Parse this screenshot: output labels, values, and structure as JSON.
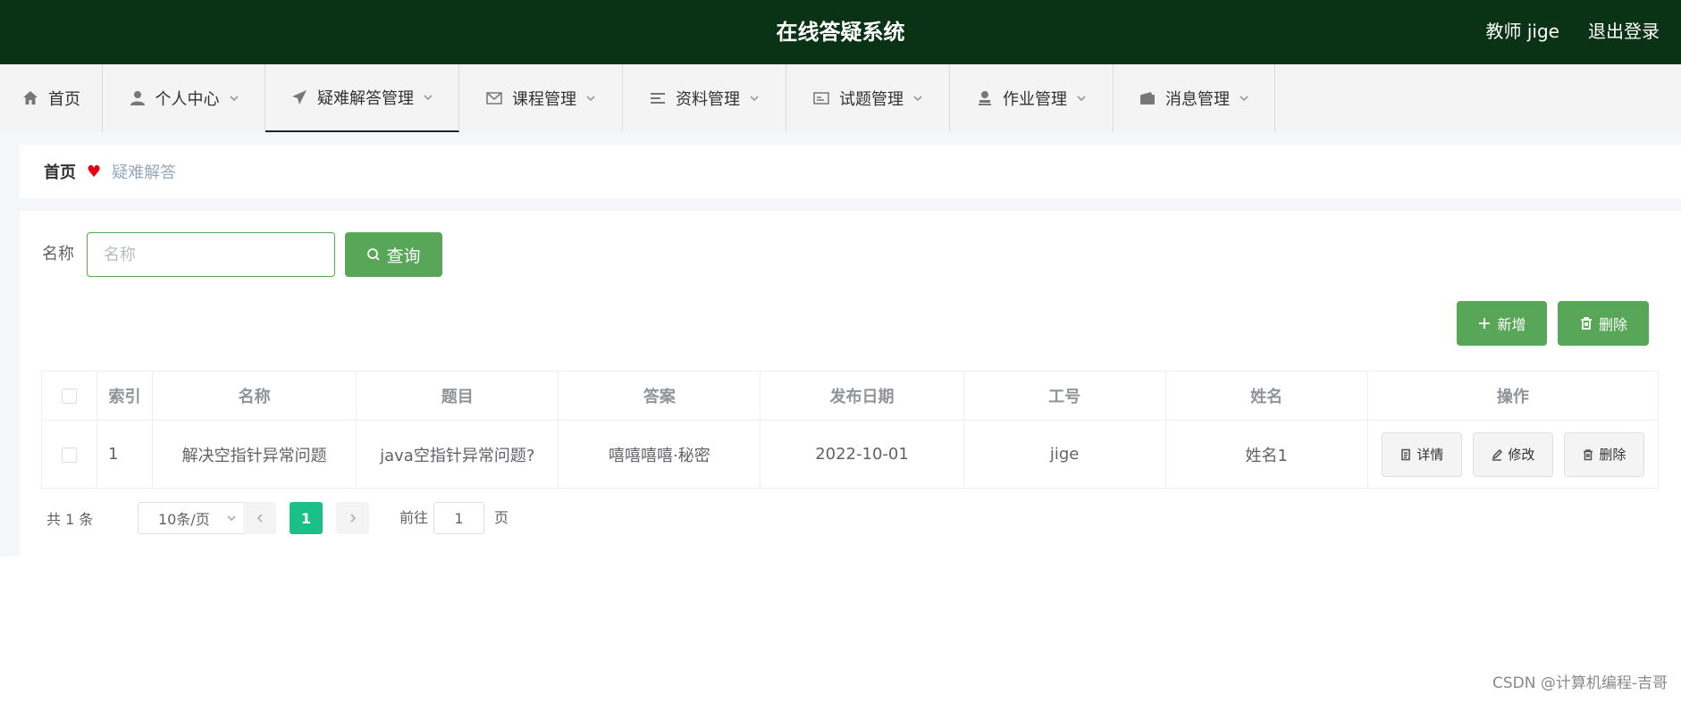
{
  "header": {
    "title": "在线答疑系统",
    "user": "教师 jige",
    "logout": "退出登录"
  },
  "nav": {
    "items": [
      {
        "label": "首页",
        "icon": "home-icon"
      },
      {
        "label": "个人中心",
        "icon": "user-icon"
      },
      {
        "label": "疑难解答管理",
        "icon": "paper-plane-icon"
      },
      {
        "label": "课程管理",
        "icon": "mail-icon"
      },
      {
        "label": "资料管理",
        "icon": "list-icon"
      },
      {
        "label": "试题管理",
        "icon": "card-icon"
      },
      {
        "label": "作业管理",
        "icon": "stamp-icon"
      },
      {
        "label": "消息管理",
        "icon": "wallet-icon"
      }
    ],
    "active_index": 2
  },
  "breadcrumb": {
    "home": "首页",
    "current": "疑难解答"
  },
  "search": {
    "label": "名称",
    "placeholder": "名称",
    "query_button": "查询"
  },
  "actions": {
    "add": "新增",
    "delete": "删除"
  },
  "table": {
    "headers": [
      "索引",
      "名称",
      "题目",
      "答案",
      "发布日期",
      "工号",
      "姓名",
      "操作"
    ],
    "rows": [
      {
        "index": "1",
        "name": "解决空指针异常问题",
        "question": "java空指针异常问题?",
        "answer": "嘻嘻嘻嘻·秘密",
        "date": "2022-10-01",
        "job_no": "jige",
        "person": "姓名1"
      }
    ],
    "row_ops": {
      "detail": "详情",
      "edit": "修改",
      "delete": "删除"
    }
  },
  "pagination": {
    "total": "共 1 条",
    "page_size": "10条/页",
    "current_page": "1",
    "goto_label": "前往",
    "goto_value": "1",
    "goto_unit": "页"
  },
  "watermark": "CSDN @计算机编程-吉哥",
  "colors": {
    "header_bg": "#0a3316",
    "primary_green": "#58a658",
    "page_active": "#1bc088"
  }
}
